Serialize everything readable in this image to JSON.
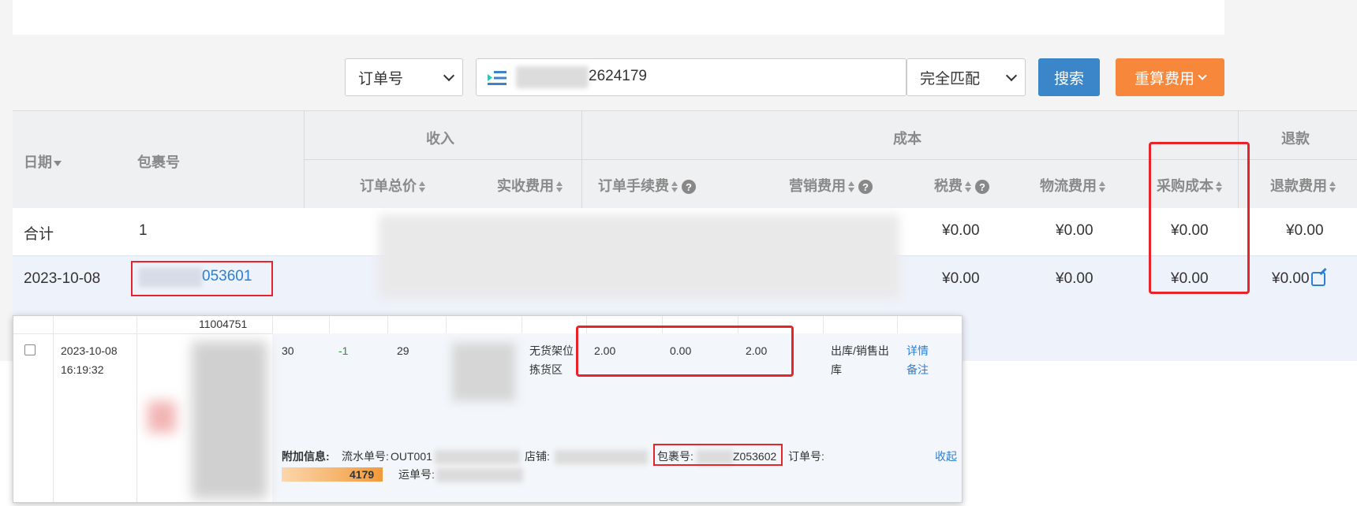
{
  "search": {
    "field_select": "订单号",
    "query_visible": "2624179",
    "match_select": "完全匹配",
    "search_button": "搜索",
    "recalc_button": "重算费用"
  },
  "table": {
    "headers": {
      "date": "日期",
      "package_no": "包裹号",
      "income_group": "收入",
      "cost_group": "成本",
      "refund_group": "退款",
      "order_total": "订单总价",
      "actual_fee": "实收费用",
      "order_fee": "订单手续费",
      "marketing_fee": "营销费用",
      "tax": "税费",
      "logistics_fee": "物流费用",
      "purchase_cost": "采购成本",
      "refund_fee": "退款费用"
    },
    "total_row": {
      "label": "合计",
      "package_count": "1",
      "tax": "¥0.00",
      "logistics": "¥0.00",
      "purchase": "¥0.00",
      "refund": "¥0.00"
    },
    "data_row": {
      "date": "2023-10-08",
      "package_visible": "053601",
      "tax": "¥0.00",
      "logistics": "¥0.00",
      "purchase": "¥0.00",
      "refund": "¥0.00"
    }
  },
  "popup": {
    "top_code": "11004751",
    "date": "2023-10-08",
    "time": "16:19:32",
    "qty1": "30",
    "qty2": "-1",
    "qty3": "29",
    "location_line1": "无货架位",
    "location_line2": "拣货区",
    "val1": "2.00",
    "val2": "0.00",
    "val3": "2.00",
    "type_line1": "出库/销售出",
    "type_line2": "库",
    "action_detail": "详情",
    "action_note": "备注",
    "extra_label": "附加信息:",
    "serial_label": "流水单号:",
    "serial_visible": "OUT001",
    "store_label": "店铺:",
    "package_label": "包裹号:",
    "package_visible": "Z053602",
    "order_label": "订单号:",
    "collapse": "收起",
    "order_visible": "4179",
    "waybill_label": "运单号:"
  }
}
